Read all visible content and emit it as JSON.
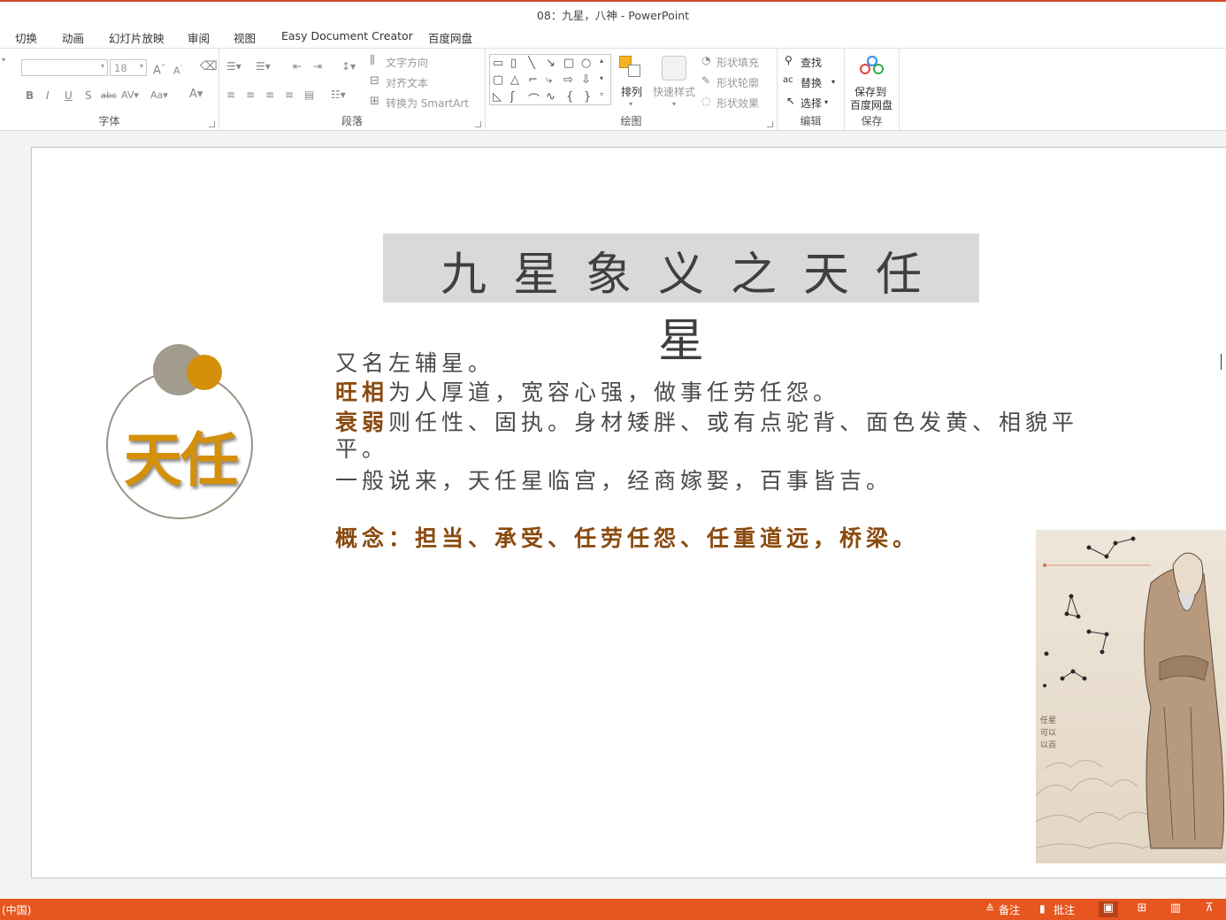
{
  "window": {
    "title": "08：九星，八神 - PowerPoint"
  },
  "menu": {
    "tabs": [
      "切换",
      "动画",
      "幻灯片放映",
      "审阅",
      "视图",
      "Easy Document Creator",
      "百度网盘"
    ]
  },
  "ribbon": {
    "font": {
      "font_name": "",
      "font_size": "18",
      "label": "字体"
    },
    "paragraph": {
      "label": "段落",
      "text_direction": "文字方向",
      "align_text": "对齐文本",
      "smartart": "转换为 SmartArt"
    },
    "drawing": {
      "label": "绘图",
      "arrange": "排列",
      "quick_styles": "快速样式",
      "shape_fill": "形状填充",
      "shape_outline": "形状轮廓",
      "shape_effects": "形状效果"
    },
    "editing": {
      "label": "编辑",
      "find": "查找",
      "replace": "替换",
      "select": "选择"
    },
    "save": {
      "label": "保存",
      "save_to": "保存到",
      "baidu": "百度网盘"
    }
  },
  "slide": {
    "title": "九星象义之天任星",
    "logo_text": "天任",
    "lines": {
      "l1": "又名左辅星。",
      "l2_hl": "旺相",
      "l2": "为人厚道，宽容心强，做事任劳任怨。",
      "l3_hl": "衰弱",
      "l3": "则任性、固执。身材矮胖、或有点驼背、面色发黄、相貌平平。",
      "l4": "一般说来，天任星临宫，经商嫁娶，百事皆吉。",
      "concept": "概念：担当、承受、任劳任怨、任重道远，桥梁。"
    },
    "painting_text": "任星可以以百"
  },
  "status": {
    "language": "(中国)",
    "notes": "备注",
    "comments": "批注"
  },
  "colors": {
    "accent": "#e7561f",
    "gold": "#d4900a",
    "brown": "#8a4a0f"
  }
}
